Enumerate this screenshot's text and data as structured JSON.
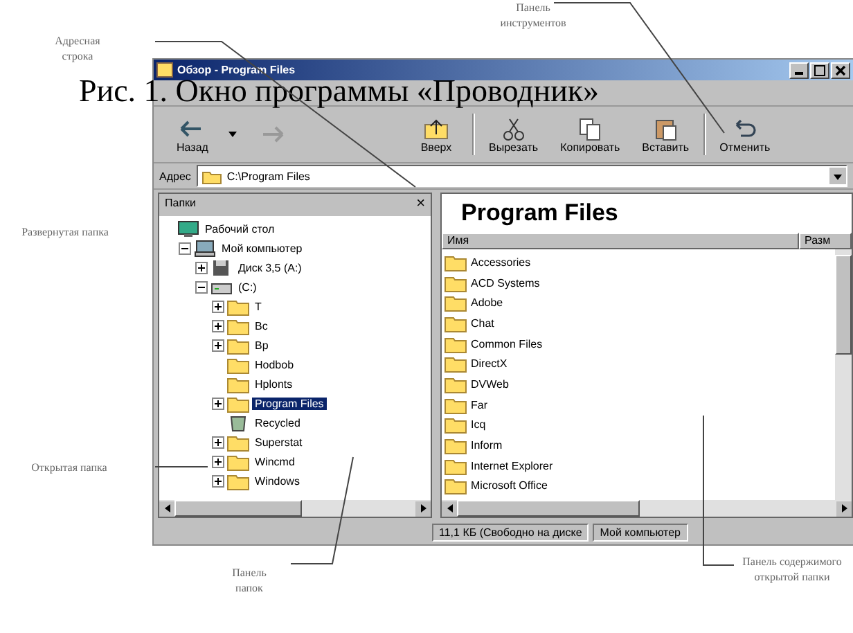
{
  "caption": "Рис. 1. Окно программы «Проводник»",
  "callouts": [
    {
      "text": "Адресная строка"
    },
    {
      "text": "Панель инструментов"
    },
    {
      "text": "Развернутая папка"
    },
    {
      "text": "Открытая папка"
    },
    {
      "text": "Панель папок"
    },
    {
      "text": "Панель содержимого открытой папки"
    }
  ],
  "window": {
    "title": "Обзор - Program Files"
  },
  "toolbar": [
    {
      "label": "Назад",
      "kind": "back"
    },
    {
      "kind": "forward"
    },
    {
      "label": "Вверх",
      "kind": "up"
    },
    {
      "label": "Вырезать",
      "kind": "cut"
    },
    {
      "label": "Копировать",
      "kind": "copy"
    },
    {
      "label": "Вставить",
      "kind": "paste"
    },
    {
      "label": "Отменить",
      "kind": "undo"
    }
  ],
  "address": {
    "label": "Адрес",
    "value": "C:\\Program Files"
  },
  "folders_pane": {
    "title": "Папки",
    "close": "×"
  },
  "tree": [
    {
      "label": "Рабочий стол",
      "kind": "desktop",
      "selected": false,
      "children": [
        {
          "label": "Мой компьютер",
          "kind": "computer",
          "expanded": true,
          "selected": false,
          "children": [
            {
              "label": "Диск 3,5 (A:)",
              "kind": "floppy",
              "expanded": false,
              "selected": false
            },
            {
              "label": "(C:)",
              "kind": "drive",
              "expanded": true,
              "selected": false,
              "children": [
                {
                  "label": "T",
                  "kind": "folder",
                  "expanded": false,
                  "selected": false
                },
                {
                  "label": "Bc",
                  "kind": "folder",
                  "expanded": false,
                  "selected": false
                },
                {
                  "label": "Bp",
                  "kind": "folder",
                  "expanded": false,
                  "selected": false
                },
                {
                  "label": "Hodbob",
                  "kind": "folder",
                  "selected": false
                },
                {
                  "label": "Hplonts",
                  "kind": "folder",
                  "selected": false
                },
                {
                  "label": "Program Files",
                  "kind": "folder",
                  "expanded": false,
                  "selected": true
                },
                {
                  "label": "Recycled",
                  "kind": "recycle",
                  "selected": false
                },
                {
                  "label": "Superstat",
                  "kind": "folder",
                  "expanded": false,
                  "selected": false
                },
                {
                  "label": "Wincmd",
                  "kind": "folder",
                  "expanded": false,
                  "selected": false
                },
                {
                  "label": "Windows",
                  "kind": "folder",
                  "expanded": false,
                  "selected": false
                }
              ]
            }
          ]
        }
      ]
    }
  ],
  "content": {
    "heading": "Program Files",
    "columns": [
      "Имя",
      "Разм"
    ],
    "items": [
      "Accessories",
      "ACD Systems",
      "Adobe",
      "Chat",
      "Common Files",
      "DirectX",
      "DVWeb",
      "Far",
      "Icq",
      "Inform",
      "Internet Explorer",
      "Microsoft Office"
    ]
  },
  "status_bar": [
    "11,1 КБ (Свободно на диске",
    "Мой компьютер"
  ]
}
